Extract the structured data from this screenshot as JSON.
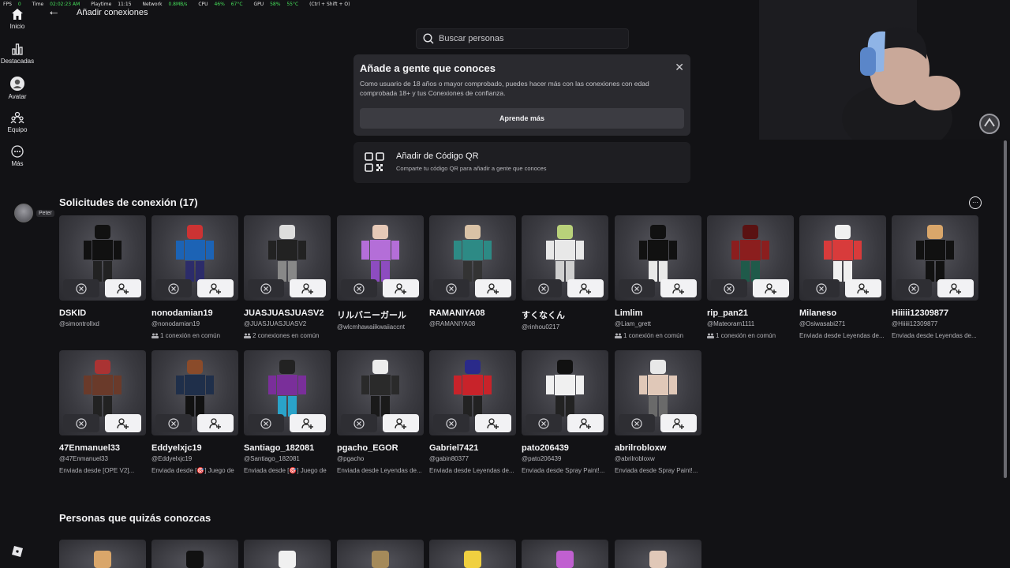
{
  "perf": {
    "fps_label": "FPS",
    "fps": "0",
    "time_label": "Time",
    "time": "02:02:23 AM",
    "playtime_label": "Playtime",
    "playtime": "11:15",
    "network_label": "Network",
    "network": "0.8MB/s",
    "cpu_label": "CPU",
    "cpu_pct": "46%",
    "cpu_temp": "67°C",
    "gpu_label": "GPU",
    "gpu_pct": "58%",
    "gpu_temp": "55°C",
    "shortcut": "(Ctrl + Shift + O)"
  },
  "nav": {
    "home": "Inicio",
    "featured": "Destacadas",
    "avatar": "Avatar",
    "team": "Equipo",
    "more": "Más"
  },
  "friend": {
    "name": "Peter"
  },
  "header": {
    "title": "Añadir conexiones"
  },
  "search": {
    "placeholder": "Buscar personas"
  },
  "info_card": {
    "title": "Añade a gente que conoces",
    "description": "Como usuario de 18 años o mayor comprobado, puedes hacer más con las conexiones con edad comprobada 18+ y tus Conexiones de confianza.",
    "button": "Aprende más"
  },
  "qr_card": {
    "title": "Añadir de Código QR",
    "description": "Comparte tu código QR para añadir a gente que conoces"
  },
  "requests": {
    "title": "Solicitudes de conexión (17)",
    "items": [
      {
        "name": "DSKID",
        "handle": "@simontrollxd",
        "extra": ""
      },
      {
        "name": "nonodamian19",
        "handle": "@nonodamian19",
        "extra": "1 conexión en común"
      },
      {
        "name": "JUASJUASJUASV2",
        "handle": "@JUASJUASJUASV2",
        "extra": "2 conexiones en común"
      },
      {
        "name": "リルバニーガール",
        "handle": "@wlcmhawaiikwaiiaccnt",
        "extra": ""
      },
      {
        "name": "RAMANIYA08",
        "handle": "@RAMANIYA08",
        "extra": ""
      },
      {
        "name": "すくなくん",
        "handle": "@rinhou0217",
        "extra": ""
      },
      {
        "name": "Limlim",
        "handle": "@Liam_grett",
        "extra": "1 conexión en común"
      },
      {
        "name": "rip_pan21",
        "handle": "@Mateoram1111",
        "extra": "1 conexión en común"
      },
      {
        "name": "Milaneso",
        "handle": "@Osiwasabi271",
        "extra": "Enviada desde Leyendas de..."
      },
      {
        "name": "Hiiiii12309877",
        "handle": "@Hiiiii12309877",
        "extra": "Enviada desde Leyendas de..."
      },
      {
        "name": "47Enmanuel33",
        "handle": "@47Enmanuel33",
        "extra": "Enviada desde [OPE V2]..."
      },
      {
        "name": "Eddyelxjc19",
        "handle": "@Eddyelxjc19",
        "extra": "Enviada desde [🎯] Juego de"
      },
      {
        "name": "Santiago_182081",
        "handle": "@Santiago_182081",
        "extra": "Enviada desde [🎯] Juego de"
      },
      {
        "name": "pgacho_EGOR",
        "handle": "@pgacho",
        "extra": "Enviada desde Leyendas de..."
      },
      {
        "name": "Gabriel7421",
        "handle": "@gabin80377",
        "extra": "Enviada desde Leyendas de..."
      },
      {
        "name": "pato206439",
        "handle": "@pato206439",
        "extra": "Enviada desde Spray Paint!..."
      },
      {
        "name": "abrilrobloxw",
        "handle": "@abrilrobloxw",
        "extra": "Enviada desde Spray Paint!..."
      }
    ]
  },
  "suggestions": {
    "title": "Personas que quizás conozcas"
  },
  "colors": {
    "background": "#121215",
    "card": "#2a2a2f",
    "accept_button": "#f2f2f4",
    "decline_button": "#2e2e33"
  }
}
